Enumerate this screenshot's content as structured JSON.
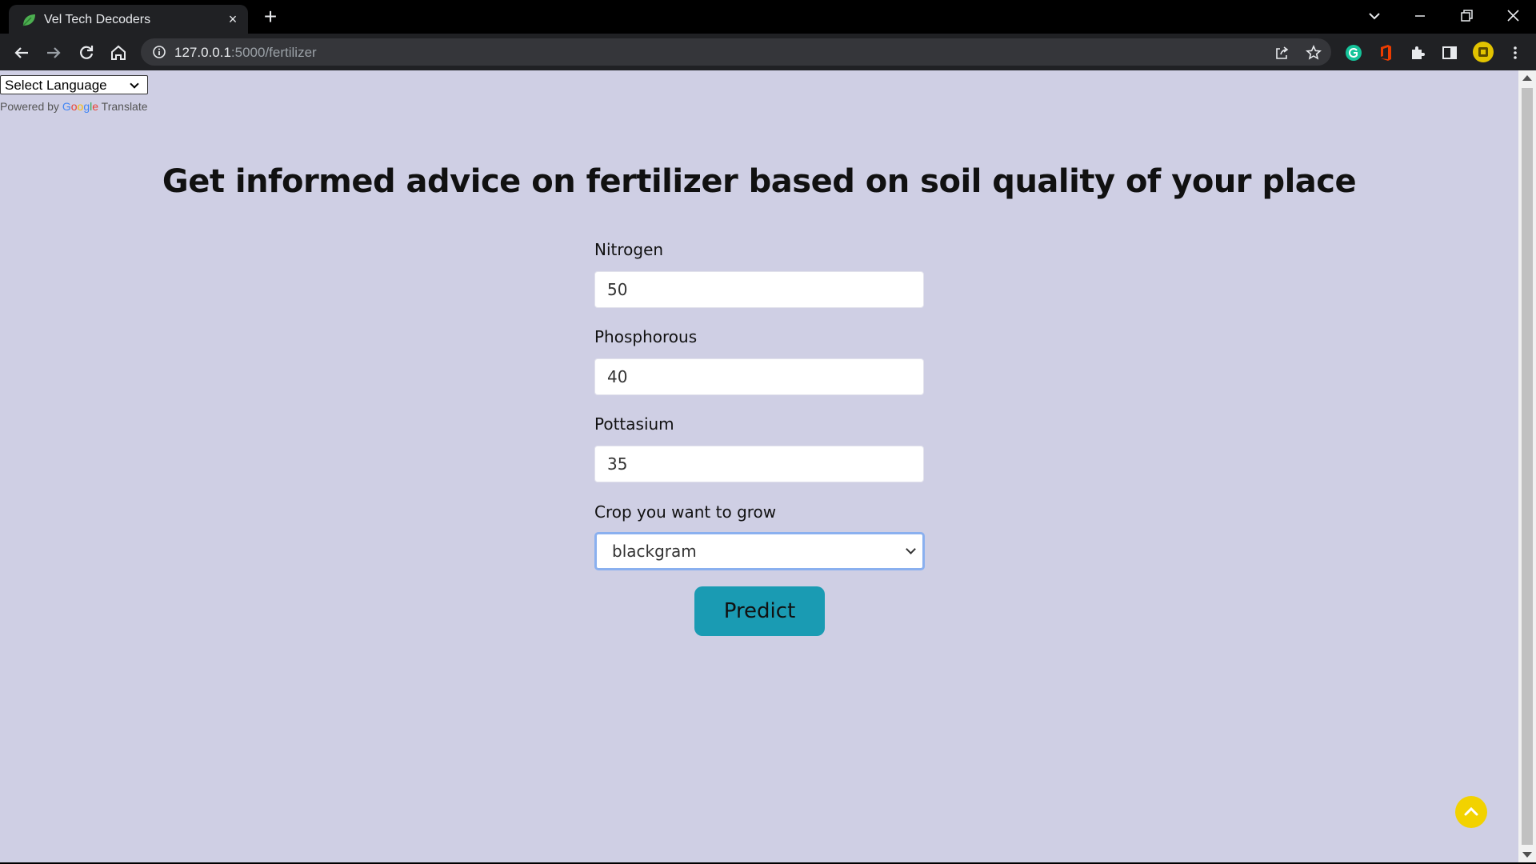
{
  "browser": {
    "tab_title": "Vel Tech Decoders",
    "tab_close_glyph": "×",
    "new_tab_glyph": "+",
    "url_host": "127.0.0.1",
    "url_rest": ":5000/fertilizer",
    "icons": [
      "leaf-favicon-icon",
      "back-arrow-icon",
      "forward-arrow-icon",
      "reload-icon",
      "home-icon",
      "info-icon",
      "share-icon",
      "star-icon",
      "grammarly-icon",
      "office-icon",
      "extensions-icon",
      "side-panel-icon",
      "profile-avatar-icon",
      "kebab-menu-icon",
      "tab-search-icon",
      "minimize-icon",
      "restore-icon",
      "close-window-icon"
    ]
  },
  "translate": {
    "select_label": "Select Language",
    "powered_by": "Powered by",
    "google_g": "G",
    "google_o1": "o",
    "google_o2": "o",
    "google_g2": "g",
    "google_l": "l",
    "google_e": "e",
    "translate_word": "Translate"
  },
  "page": {
    "heading": "Get informed advice on fertilizer based on soil quality of your place",
    "nitrogen_label": "Nitrogen",
    "nitrogen_value": "50",
    "phosphorous_label": "Phosphorous",
    "phosphorous_value": "40",
    "pottasium_label": "Pottasium",
    "pottasium_value": "35",
    "crop_label": "Crop you want to grow",
    "crop_value": "blackgram",
    "predict_label": "Predict"
  },
  "colors": {
    "page_bg": "#cfcfe4",
    "predict_bg": "#1a9bb3",
    "scroll_top_bg": "#f2d200",
    "select_focus": "#8ab0ef"
  }
}
